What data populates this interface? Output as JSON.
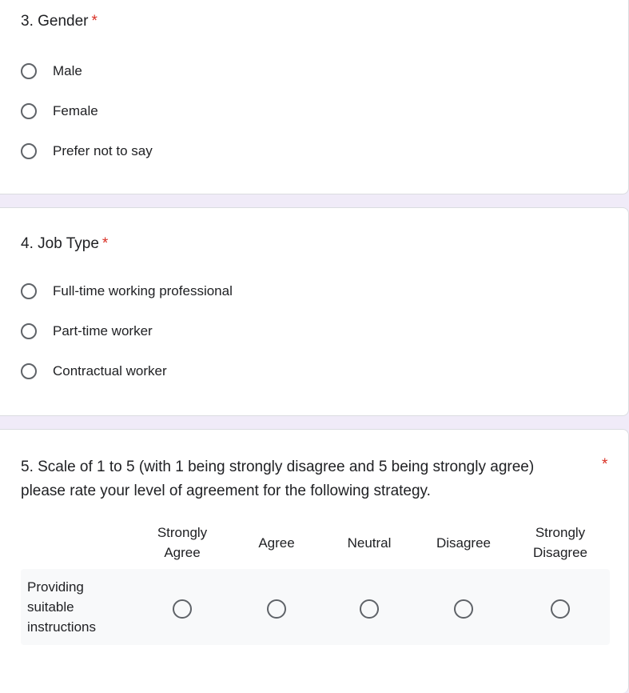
{
  "questions": {
    "gender": {
      "title": "3. Gender",
      "required_mark": "*",
      "options": [
        "Male",
        "Female",
        "Prefer not to say"
      ]
    },
    "job_type": {
      "title": "4. Job Type",
      "required_mark": "*",
      "options": [
        "Full-time working professional",
        "Part-time worker",
        "Contractual worker"
      ]
    },
    "scale": {
      "title": "5. Scale of 1 to 5 (with 1 being strongly disagree and 5 being strongly agree) please rate your level of agreement for the following strategy.",
      "required_mark": "*",
      "columns": [
        "Strongly Agree",
        "Agree",
        "Neutral",
        "Disagree",
        "Strongly Disagree"
      ],
      "rows": [
        "Providing suitable instructions"
      ]
    }
  },
  "colors": {
    "required": "#d93025",
    "radio_border": "#5f6368",
    "page_background": "#f0ebf8",
    "grid_row_background": "#f8f9fa"
  }
}
